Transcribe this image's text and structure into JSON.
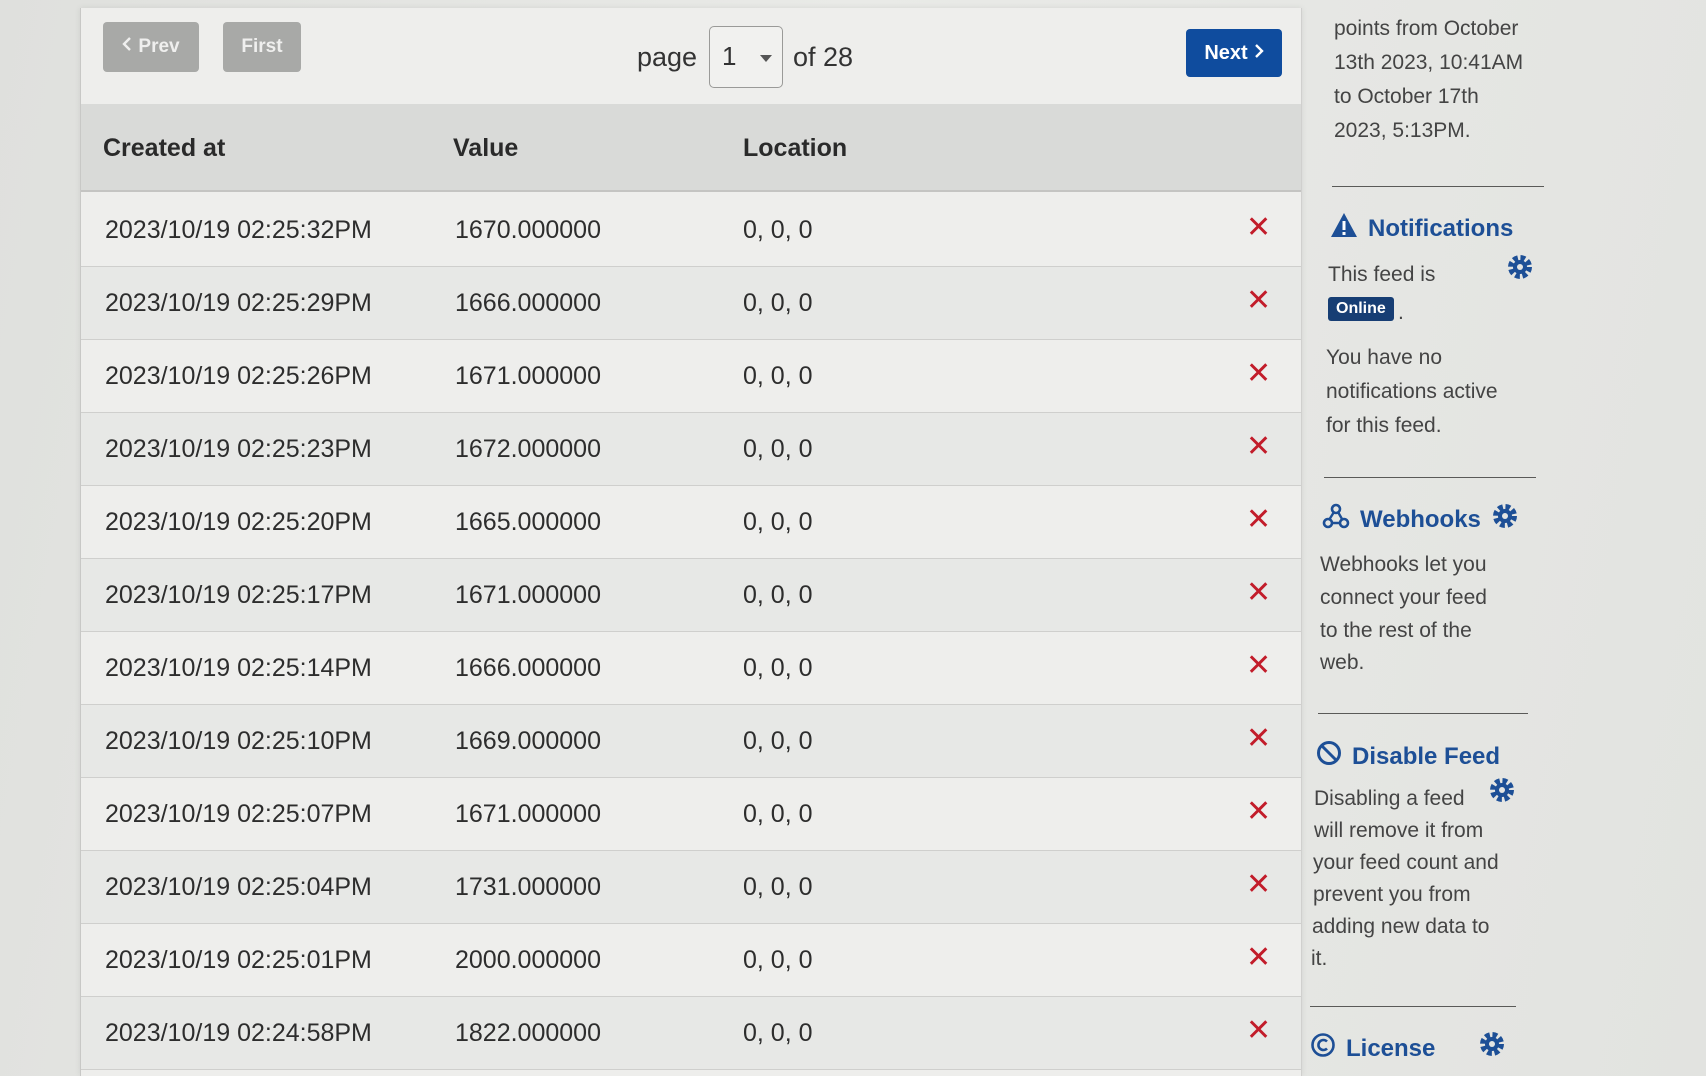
{
  "pagination": {
    "prev_label": "Prev",
    "first_label": "First",
    "page_label": "page",
    "current_page": "1",
    "total_label": "of 28",
    "next_label": "Next"
  },
  "table": {
    "headers": {
      "created": "Created at",
      "value": "Value",
      "location": "Location"
    },
    "rows": [
      {
        "created": "2023/10/19 02:25:32PM",
        "value": "1670.000000",
        "location": "0, 0, 0"
      },
      {
        "created": "2023/10/19 02:25:29PM",
        "value": "1666.000000",
        "location": "0, 0, 0"
      },
      {
        "created": "2023/10/19 02:25:26PM",
        "value": "1671.000000",
        "location": "0, 0, 0"
      },
      {
        "created": "2023/10/19 02:25:23PM",
        "value": "1672.000000",
        "location": "0, 0, 0"
      },
      {
        "created": "2023/10/19 02:25:20PM",
        "value": "1665.000000",
        "location": "0, 0, 0"
      },
      {
        "created": "2023/10/19 02:25:17PM",
        "value": "1671.000000",
        "location": "0, 0, 0"
      },
      {
        "created": "2023/10/19 02:25:14PM",
        "value": "1666.000000",
        "location": "0, 0, 0"
      },
      {
        "created": "2023/10/19 02:25:10PM",
        "value": "1669.000000",
        "location": "0, 0, 0"
      },
      {
        "created": "2023/10/19 02:25:07PM",
        "value": "1671.000000",
        "location": "0, 0, 0"
      },
      {
        "created": "2023/10/19 02:25:04PM",
        "value": "1731.000000",
        "location": "0, 0, 0"
      },
      {
        "created": "2023/10/19 02:25:01PM",
        "value": "2000.000000",
        "location": "0, 0, 0"
      },
      {
        "created": "2023/10/19 02:24:58PM",
        "value": "1822.000000",
        "location": "0, 0, 0"
      }
    ],
    "delete_glyph": "✕"
  },
  "sidebar": {
    "summary_lines": [
      "points from October",
      "13th 2023, 10:41AM",
      "to October 17th",
      "2023, 5:13PM."
    ],
    "notifications": {
      "title": "Notifications",
      "status_prefix": "This feed is",
      "status_badge": "Online",
      "status_suffix": ".",
      "body_lines": [
        "You have no",
        "notifications active",
        "for this feed."
      ]
    },
    "webhooks": {
      "title": "Webhooks",
      "body_lines": [
        "Webhooks let you",
        "connect your feed",
        "to the rest of the",
        "web."
      ]
    },
    "disable": {
      "title": "Disable Feed",
      "body_lines": [
        "Disabling a feed",
        "will remove it from",
        "your feed count and",
        "prevent you from",
        "adding new data to",
        "it."
      ]
    },
    "license": {
      "title": "License"
    }
  },
  "colors": {
    "accent": "#0f4c9e",
    "heading": "#1d4f96",
    "delete": "#c21c2a",
    "badge": "#173e74"
  }
}
